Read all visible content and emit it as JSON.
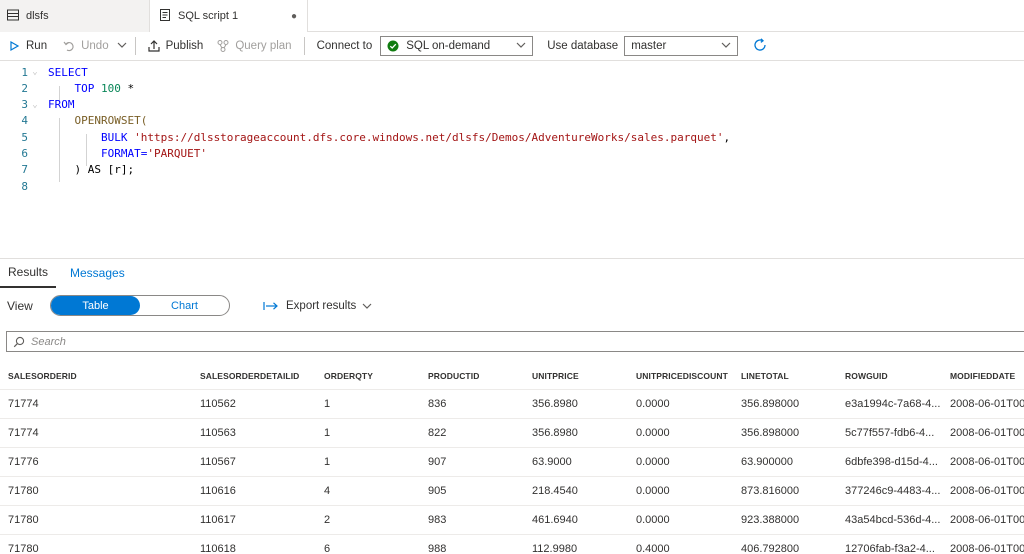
{
  "tabs": [
    {
      "label": "dlsfs"
    },
    {
      "label": "SQL script 1",
      "modified_dot": "●"
    }
  ],
  "toolbar": {
    "run": "Run",
    "undo": "Undo",
    "publish": "Publish",
    "query_plan": "Query plan",
    "connect_to_label": "Connect to",
    "connect_to_value": "SQL on-demand",
    "use_database_label": "Use database",
    "use_database_value": "master"
  },
  "editor": {
    "lines": [
      {
        "num": "1",
        "tokens": [
          {
            "t": "SELECT",
            "c": "kw"
          }
        ]
      },
      {
        "num": "2",
        "tokens": [
          {
            "t": "    TOP ",
            "c": "kw"
          },
          {
            "t": "100",
            "c": "num"
          },
          {
            "t": " *",
            "c": ""
          }
        ]
      },
      {
        "num": "3",
        "tokens": [
          {
            "t": "FROM",
            "c": "kw"
          }
        ]
      },
      {
        "num": "4",
        "tokens": [
          {
            "t": "    OPENROWSET(",
            "c": "fn"
          }
        ]
      },
      {
        "num": "5",
        "tokens": [
          {
            "t": "        BULK ",
            "c": "kw"
          },
          {
            "t": "'https://dlsstorageaccount.dfs.core.windows.net/dlsfs/Demos/AdventureWorks/sales.parquet'",
            "c": "str"
          },
          {
            "t": ",",
            "c": ""
          }
        ]
      },
      {
        "num": "6",
        "tokens": [
          {
            "t": "        FORMAT=",
            "c": "kw"
          },
          {
            "t": "'PARQUET'",
            "c": "str"
          }
        ]
      },
      {
        "num": "7",
        "tokens": [
          {
            "t": "    ) AS [r];",
            "c": ""
          }
        ]
      },
      {
        "num": "8",
        "tokens": []
      }
    ]
  },
  "results": {
    "tabs": [
      "Results",
      "Messages"
    ],
    "view_label": "View",
    "view_options": [
      "Table",
      "Chart"
    ],
    "export_label": "Export results",
    "search_placeholder": "Search",
    "columns": [
      "SALESORDERID",
      "SALESORDERDETAILID",
      "ORDERQTY",
      "PRODUCTID",
      "UNITPRICE",
      "UNITPRICEDISCOUNT",
      "LINETOTAL",
      "ROWGUID",
      "MODIFIEDDATE"
    ],
    "rows": [
      [
        "71774",
        "110562",
        "1",
        "836",
        "356.8980",
        "0.0000",
        "356.898000",
        "e3a1994c-7a68-4...",
        "2008-06-01T00"
      ],
      [
        "71774",
        "110563",
        "1",
        "822",
        "356.8980",
        "0.0000",
        "356.898000",
        "5c77f557-fdb6-4...",
        "2008-06-01T00"
      ],
      [
        "71776",
        "110567",
        "1",
        "907",
        "63.9000",
        "0.0000",
        "63.900000",
        "6dbfe398-d15d-4...",
        "2008-06-01T00"
      ],
      [
        "71780",
        "110616",
        "4",
        "905",
        "218.4540",
        "0.0000",
        "873.816000",
        "377246c9-4483-4...",
        "2008-06-01T00"
      ],
      [
        "71780",
        "110617",
        "2",
        "983",
        "461.6940",
        "0.0000",
        "923.388000",
        "43a54bcd-536d-4...",
        "2008-06-01T00"
      ],
      [
        "71780",
        "110618",
        "6",
        "988",
        "112.9980",
        "0.4000",
        "406.792800",
        "12706fab-f3a2-4...",
        "2008-06-01T00"
      ]
    ]
  },
  "colors": {
    "accent": "#0078d4",
    "status_ok": "#107c10"
  }
}
